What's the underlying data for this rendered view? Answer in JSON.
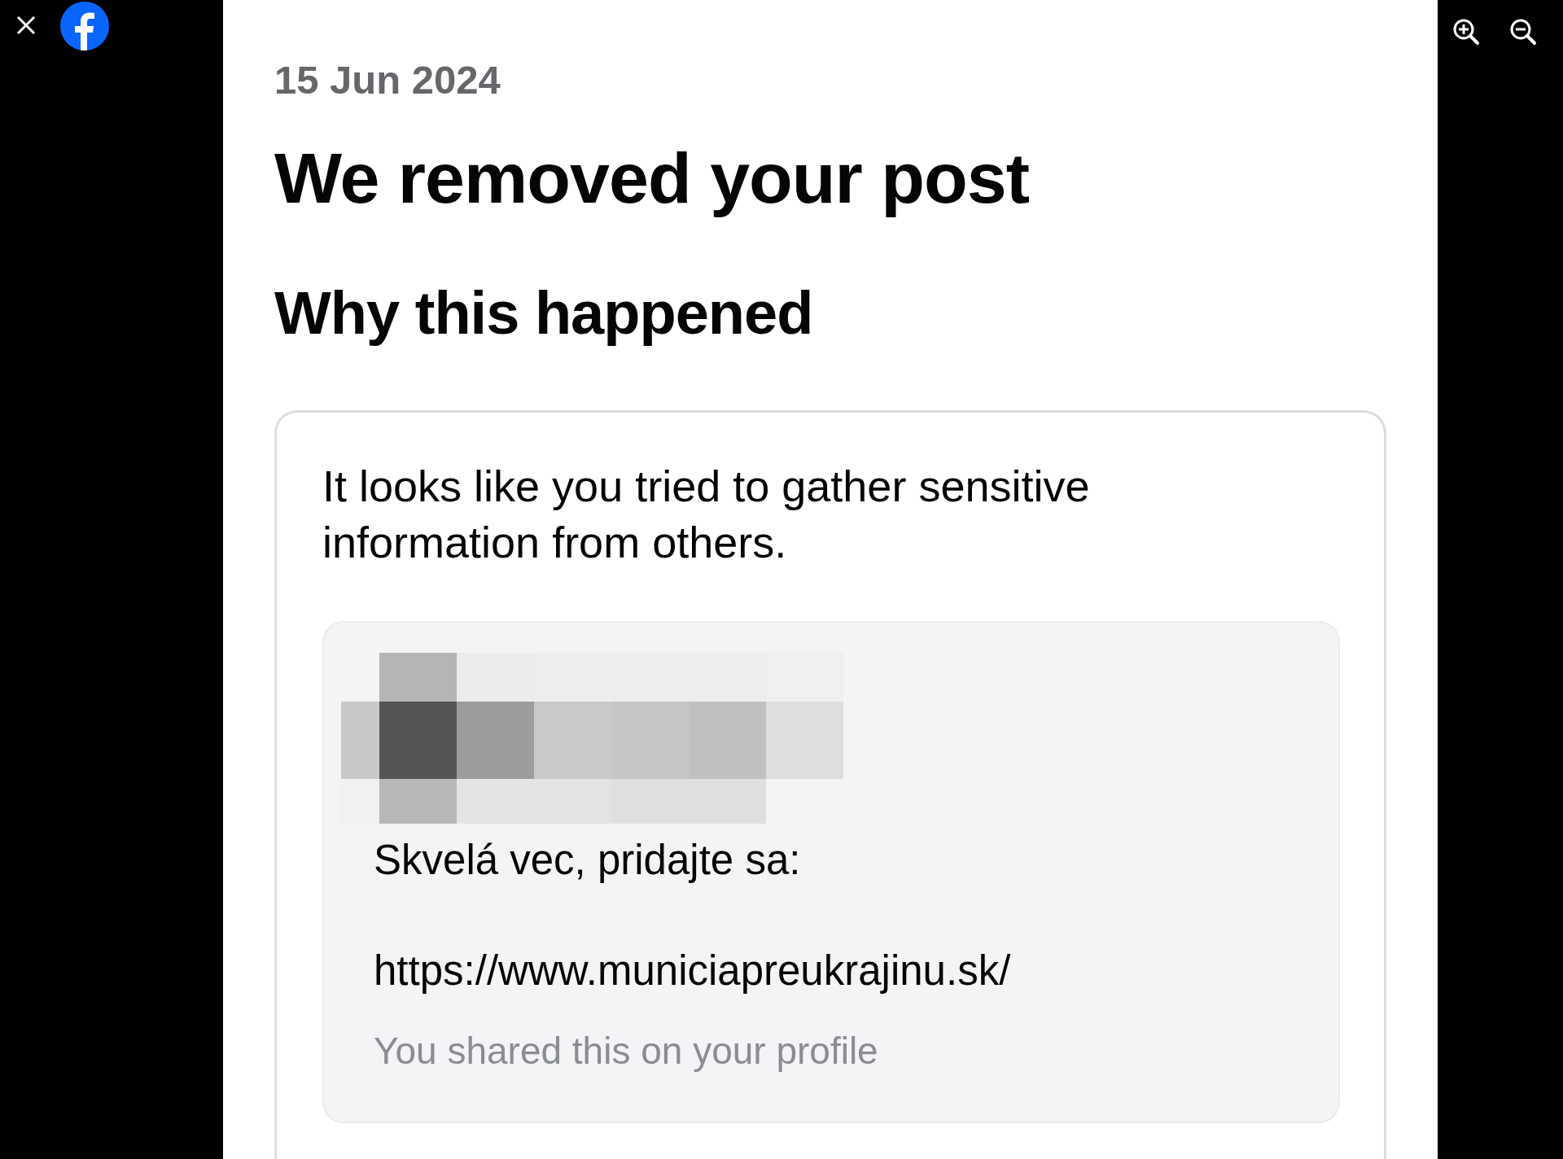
{
  "notice": {
    "date": "15 Jun 2024",
    "title": "We removed your post",
    "heading": "Why this happened",
    "reason": "It looks like you tried to gather sensitive information from others.",
    "post": {
      "text": "Skvelá vec, pridajte sa:",
      "link": "https://www.municiapreukrajinu.sk/",
      "note": "You shared this on your profile"
    }
  }
}
